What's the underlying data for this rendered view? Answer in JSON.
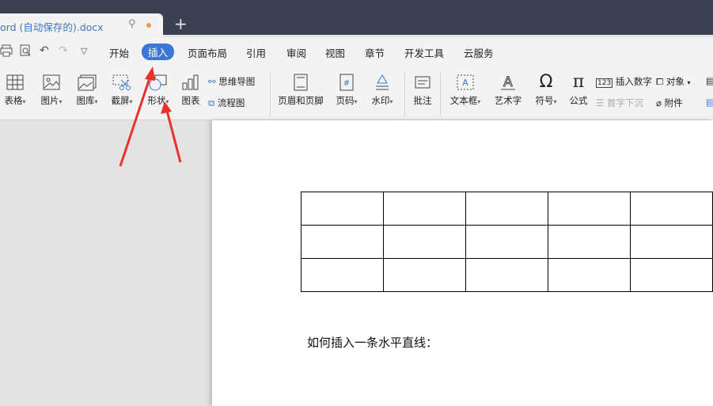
{
  "titlebar": {
    "doc_name": "ord (自动保存的).docx",
    "new_tab": "+"
  },
  "menu": {
    "items": [
      "开始",
      "插入",
      "页面布局",
      "引用",
      "审阅",
      "视图",
      "章节",
      "开发工具",
      "云服务"
    ],
    "active": "插入"
  },
  "ribbon": {
    "table": "表格",
    "picture": "图片",
    "gallery": "图库",
    "screenshot": "截屏",
    "shape": "形状",
    "chart": "图表",
    "mindmap": "思维导图",
    "flowchart": "流程图",
    "header_footer": "页眉和页脚",
    "page_number": "页码",
    "watermark": "水印",
    "comment": "批注",
    "textbox": "文本框",
    "wordart": "艺术字",
    "symbol": "符号",
    "formula": "公式",
    "insert_number": "插入数字",
    "drop_cap": "首字下沉",
    "object": "对象",
    "attachment": "附件"
  },
  "document": {
    "table_rows": 3,
    "table_cols_visible": 5,
    "body_text": "如何插入一条水平直线："
  },
  "colors": {
    "accent": "#3b78d6",
    "arrow": "#e8322a",
    "titlebar": "#3c4050"
  }
}
